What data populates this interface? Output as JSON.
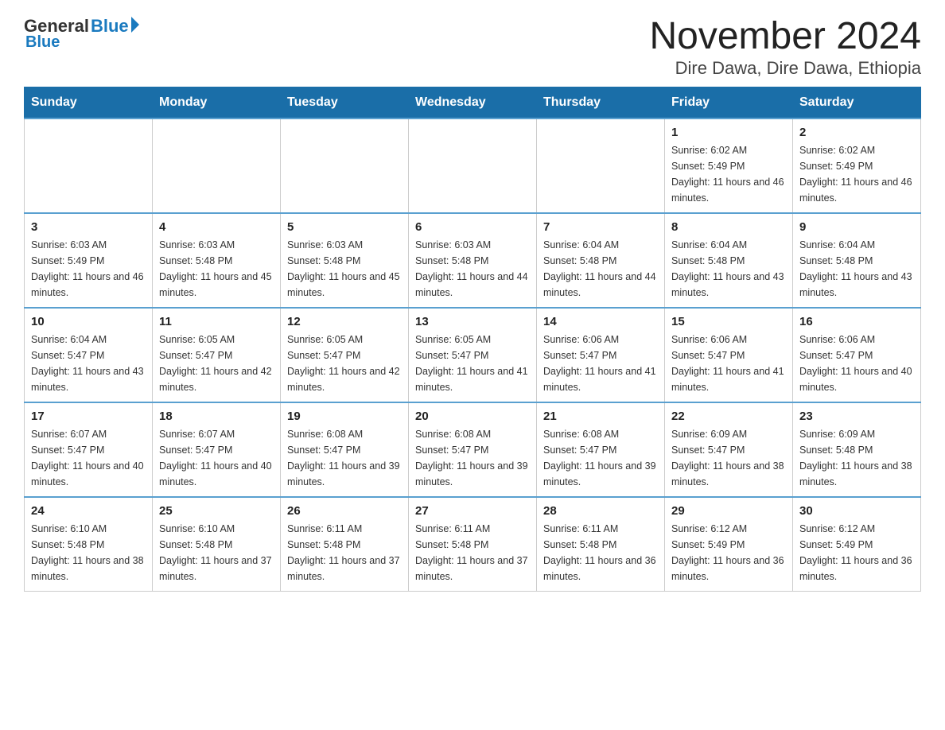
{
  "header": {
    "logo_general": "General",
    "logo_blue": "Blue",
    "title": "November 2024",
    "subtitle": "Dire Dawa, Dire Dawa, Ethiopia"
  },
  "days_of_week": [
    "Sunday",
    "Monday",
    "Tuesday",
    "Wednesday",
    "Thursday",
    "Friday",
    "Saturday"
  ],
  "weeks": [
    [
      {
        "day": "",
        "info": ""
      },
      {
        "day": "",
        "info": ""
      },
      {
        "day": "",
        "info": ""
      },
      {
        "day": "",
        "info": ""
      },
      {
        "day": "",
        "info": ""
      },
      {
        "day": "1",
        "info": "Sunrise: 6:02 AM\nSunset: 5:49 PM\nDaylight: 11 hours and 46 minutes."
      },
      {
        "day": "2",
        "info": "Sunrise: 6:02 AM\nSunset: 5:49 PM\nDaylight: 11 hours and 46 minutes."
      }
    ],
    [
      {
        "day": "3",
        "info": "Sunrise: 6:03 AM\nSunset: 5:49 PM\nDaylight: 11 hours and 46 minutes."
      },
      {
        "day": "4",
        "info": "Sunrise: 6:03 AM\nSunset: 5:48 PM\nDaylight: 11 hours and 45 minutes."
      },
      {
        "day": "5",
        "info": "Sunrise: 6:03 AM\nSunset: 5:48 PM\nDaylight: 11 hours and 45 minutes."
      },
      {
        "day": "6",
        "info": "Sunrise: 6:03 AM\nSunset: 5:48 PM\nDaylight: 11 hours and 44 minutes."
      },
      {
        "day": "7",
        "info": "Sunrise: 6:04 AM\nSunset: 5:48 PM\nDaylight: 11 hours and 44 minutes."
      },
      {
        "day": "8",
        "info": "Sunrise: 6:04 AM\nSunset: 5:48 PM\nDaylight: 11 hours and 43 minutes."
      },
      {
        "day": "9",
        "info": "Sunrise: 6:04 AM\nSunset: 5:48 PM\nDaylight: 11 hours and 43 minutes."
      }
    ],
    [
      {
        "day": "10",
        "info": "Sunrise: 6:04 AM\nSunset: 5:47 PM\nDaylight: 11 hours and 43 minutes."
      },
      {
        "day": "11",
        "info": "Sunrise: 6:05 AM\nSunset: 5:47 PM\nDaylight: 11 hours and 42 minutes."
      },
      {
        "day": "12",
        "info": "Sunrise: 6:05 AM\nSunset: 5:47 PM\nDaylight: 11 hours and 42 minutes."
      },
      {
        "day": "13",
        "info": "Sunrise: 6:05 AM\nSunset: 5:47 PM\nDaylight: 11 hours and 41 minutes."
      },
      {
        "day": "14",
        "info": "Sunrise: 6:06 AM\nSunset: 5:47 PM\nDaylight: 11 hours and 41 minutes."
      },
      {
        "day": "15",
        "info": "Sunrise: 6:06 AM\nSunset: 5:47 PM\nDaylight: 11 hours and 41 minutes."
      },
      {
        "day": "16",
        "info": "Sunrise: 6:06 AM\nSunset: 5:47 PM\nDaylight: 11 hours and 40 minutes."
      }
    ],
    [
      {
        "day": "17",
        "info": "Sunrise: 6:07 AM\nSunset: 5:47 PM\nDaylight: 11 hours and 40 minutes."
      },
      {
        "day": "18",
        "info": "Sunrise: 6:07 AM\nSunset: 5:47 PM\nDaylight: 11 hours and 40 minutes."
      },
      {
        "day": "19",
        "info": "Sunrise: 6:08 AM\nSunset: 5:47 PM\nDaylight: 11 hours and 39 minutes."
      },
      {
        "day": "20",
        "info": "Sunrise: 6:08 AM\nSunset: 5:47 PM\nDaylight: 11 hours and 39 minutes."
      },
      {
        "day": "21",
        "info": "Sunrise: 6:08 AM\nSunset: 5:47 PM\nDaylight: 11 hours and 39 minutes."
      },
      {
        "day": "22",
        "info": "Sunrise: 6:09 AM\nSunset: 5:47 PM\nDaylight: 11 hours and 38 minutes."
      },
      {
        "day": "23",
        "info": "Sunrise: 6:09 AM\nSunset: 5:48 PM\nDaylight: 11 hours and 38 minutes."
      }
    ],
    [
      {
        "day": "24",
        "info": "Sunrise: 6:10 AM\nSunset: 5:48 PM\nDaylight: 11 hours and 38 minutes."
      },
      {
        "day": "25",
        "info": "Sunrise: 6:10 AM\nSunset: 5:48 PM\nDaylight: 11 hours and 37 minutes."
      },
      {
        "day": "26",
        "info": "Sunrise: 6:11 AM\nSunset: 5:48 PM\nDaylight: 11 hours and 37 minutes."
      },
      {
        "day": "27",
        "info": "Sunrise: 6:11 AM\nSunset: 5:48 PM\nDaylight: 11 hours and 37 minutes."
      },
      {
        "day": "28",
        "info": "Sunrise: 6:11 AM\nSunset: 5:48 PM\nDaylight: 11 hours and 36 minutes."
      },
      {
        "day": "29",
        "info": "Sunrise: 6:12 AM\nSunset: 5:49 PM\nDaylight: 11 hours and 36 minutes."
      },
      {
        "day": "30",
        "info": "Sunrise: 6:12 AM\nSunset: 5:49 PM\nDaylight: 11 hours and 36 minutes."
      }
    ]
  ]
}
